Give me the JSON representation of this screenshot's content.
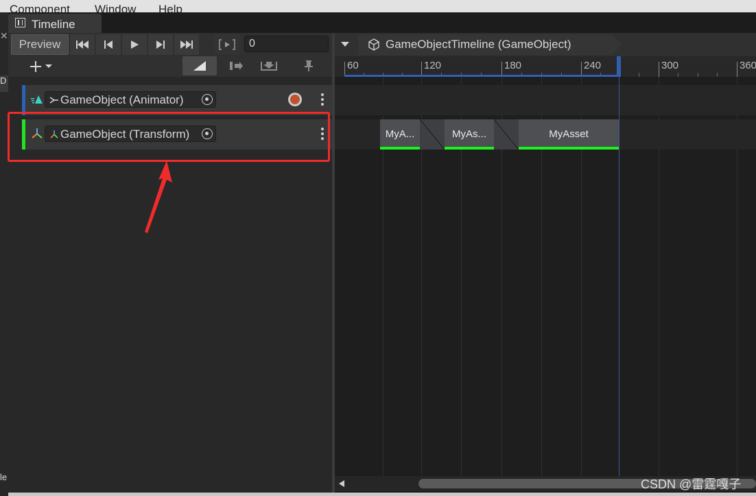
{
  "menu": [
    "Component",
    "Window",
    "Help"
  ],
  "window": {
    "tab_label": "Timeline"
  },
  "toolbar": {
    "preview_label": "Preview",
    "frame_value": "0",
    "breadcrumb": "GameObjectTimeline (GameObject)"
  },
  "tracks": [
    {
      "binding": "GameObject (Animator)",
      "accent": "#2a62b5",
      "recording": true
    },
    {
      "binding": "GameObject (Transform)",
      "accent": "#22e422",
      "selected": true
    }
  ],
  "ruler": {
    "labels": [
      "60",
      "120",
      "180",
      "240",
      "300",
      "360"
    ]
  },
  "clips": [
    {
      "label": "MyA..."
    },
    {
      "label": "MyAs..."
    },
    {
      "label": "MyAsset"
    }
  ],
  "left_strip": [
    "D",
    "le"
  ],
  "watermark": "CSDN @雷霆嘎子",
  "colors": {
    "annotation": "#ef2b2b",
    "clip_underline": "#1cf21c",
    "playhead": "#2f5fb8"
  }
}
